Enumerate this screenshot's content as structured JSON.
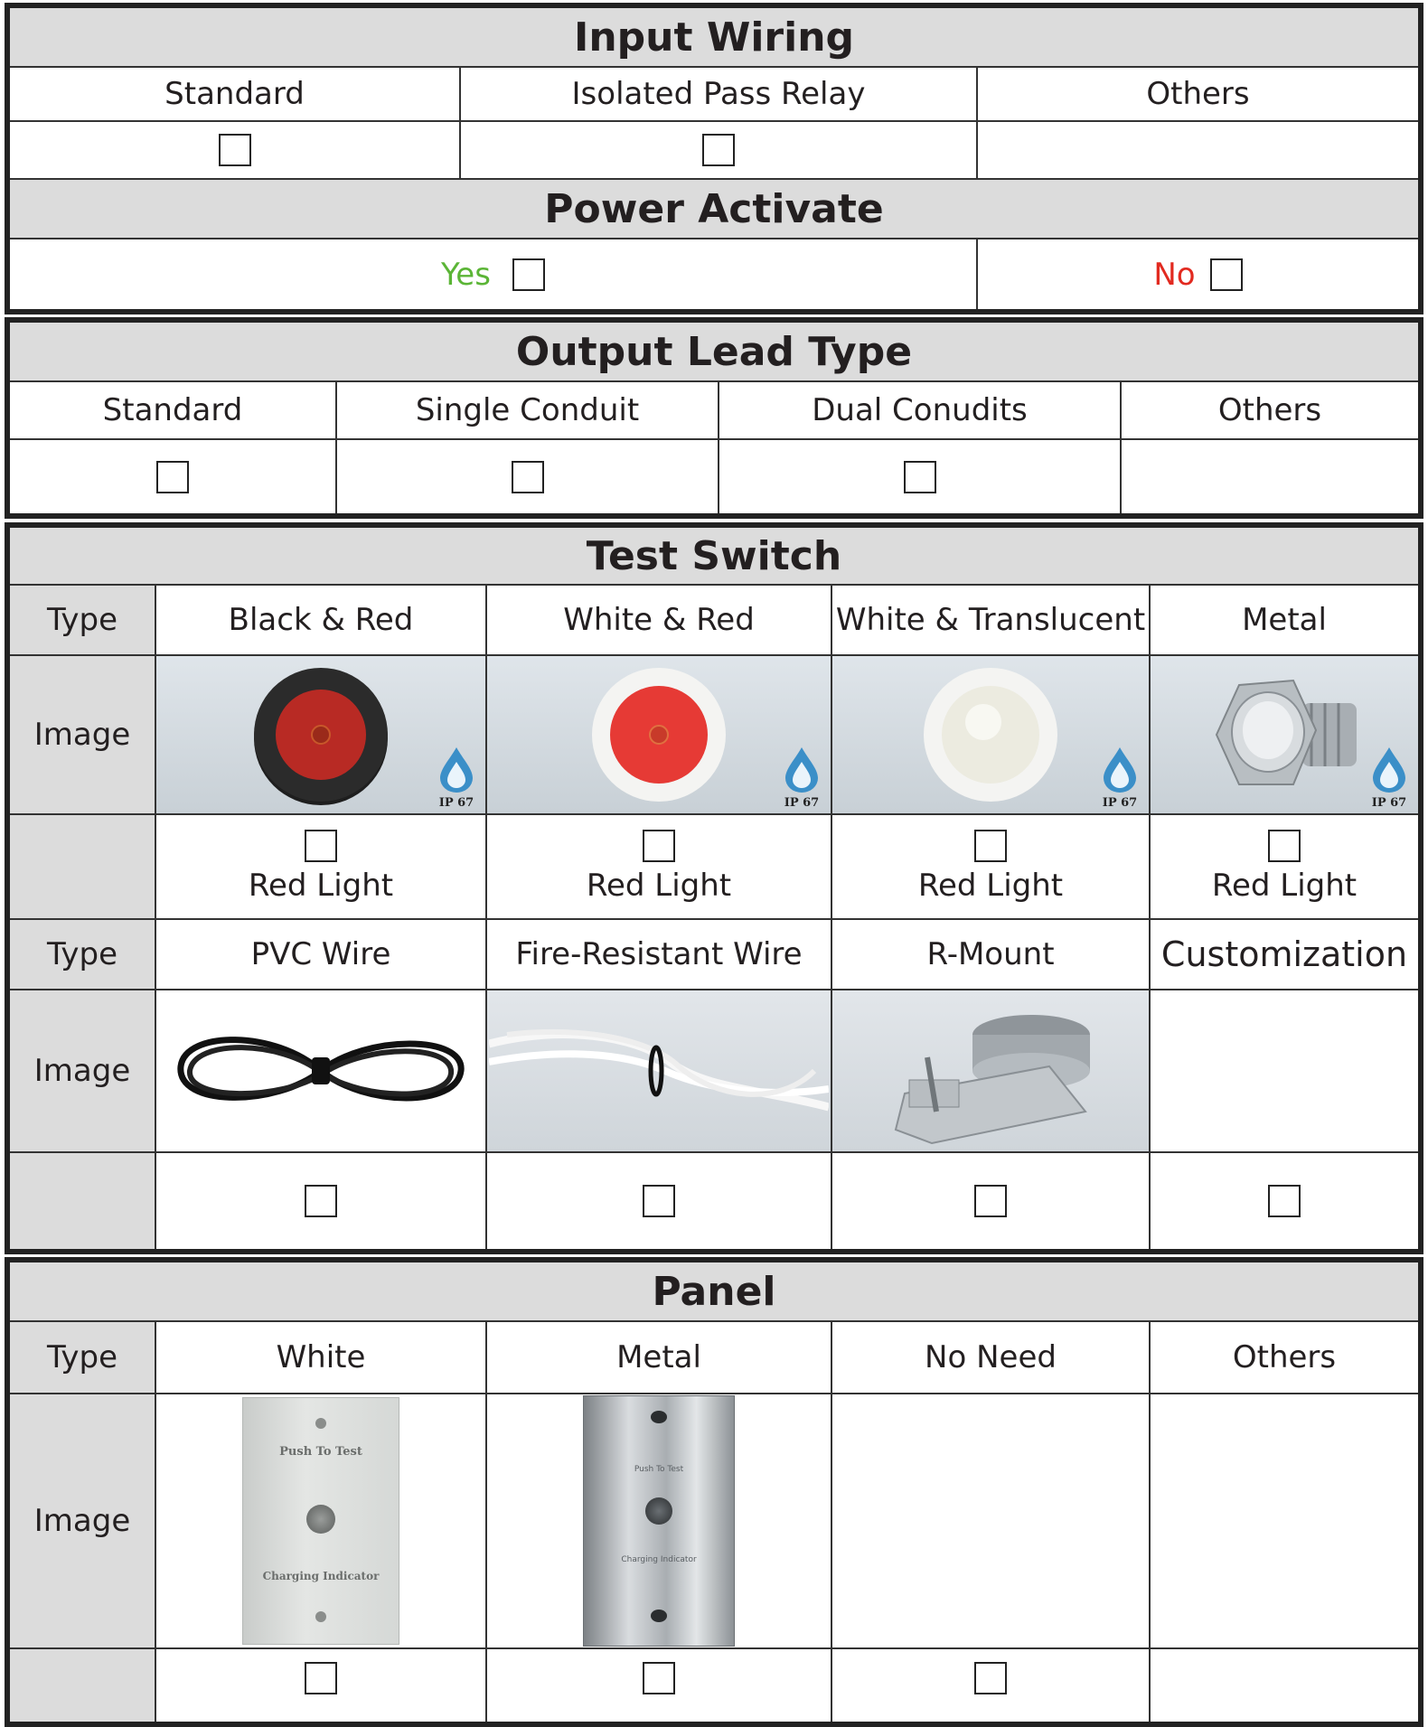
{
  "input_wiring": {
    "title": "Input Wiring",
    "options": [
      "Standard",
      "Isolated Pass Relay",
      "Others"
    ]
  },
  "power_activate": {
    "title": "Power Activate",
    "yes_label": "Yes",
    "no_label": "No",
    "yes_color": "#5bb536",
    "no_color": "#e22a20"
  },
  "output_lead_type": {
    "title": "Output Lead Type",
    "options": [
      "Standard",
      "Single Conduit",
      "Dual Conudits",
      "Others"
    ]
  },
  "test_switch": {
    "title": "Test Switch",
    "row_type": "Type",
    "row_image": "Image",
    "switches": [
      "Black & Red",
      "White & Red",
      "White & Translucent",
      "Metal"
    ],
    "ip_rating": "IP 67",
    "light_label": "Red Light",
    "wires": [
      "PVC Wire",
      "Fire-Resistant Wire",
      "R-Mount",
      "Customization"
    ]
  },
  "panel": {
    "title": "Panel",
    "row_type": "Type",
    "row_image": "Image",
    "options": [
      "White",
      "Metal",
      "No Need",
      "Others"
    ],
    "panel_push": "Push To Test",
    "panel_charging": "Charging Indicator"
  }
}
